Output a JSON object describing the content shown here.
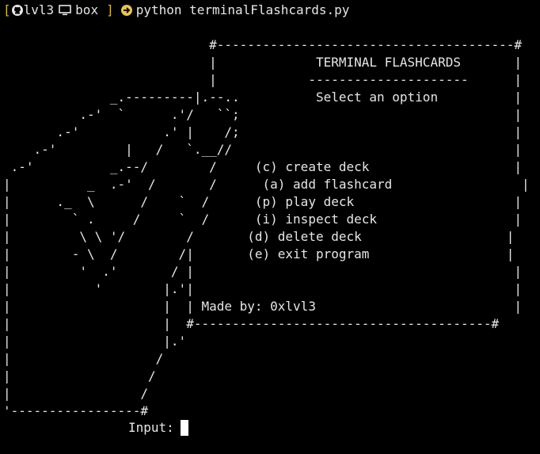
{
  "prompt": {
    "open_bracket": "[",
    "user": "lvl3",
    "host": "box",
    "close_bracket": "]",
    "command": "python terminalFlashcards.py",
    "icons": [
      "github-icon",
      "monitor-icon",
      "arrow-circle-icon"
    ],
    "colors": {
      "bracket": "#d8b64c",
      "arrow": "#e8c25a",
      "text": "#e6e6e6"
    }
  },
  "screen": {
    "lines": [
      "                           #---------------------------------------#",
      "                           |             TERMINAL FLASHCARDS       |",
      "                           |            ---------------------      |",
      "              _.---------|.--..          Select an option          |",
      "          .-'  `      .'/   ``;                                    |",
      "       .-'           .' |    /;                                    |",
      "    .-'         |   /   `.__//                                     |",
      " .-'          _.--/        /     (c) create deck                   |",
      "|          _  .-'  /       /      (a) add flashcard                 |",
      "|      ._  \\      /    `  /      (p) play deck                     |",
      "|        ` .     /     `  /      (i) inspect deck                  |",
      "|         \\ \\ '/        /       (d) delete deck                   |",
      "|        - \\  /        /|       (e) exit program                  |",
      "|         '  .'       / |                                          |",
      "|           '        |.'|                                          |",
      "|                    |  | Made by: 0xlvl3                          |",
      "|                    |  #---------------------------------------#",
      "|                    |.'",
      "|                   /",
      "|                  /",
      "|                 /",
      "'-----------------#"
    ]
  },
  "input": {
    "label": "Input:"
  }
}
